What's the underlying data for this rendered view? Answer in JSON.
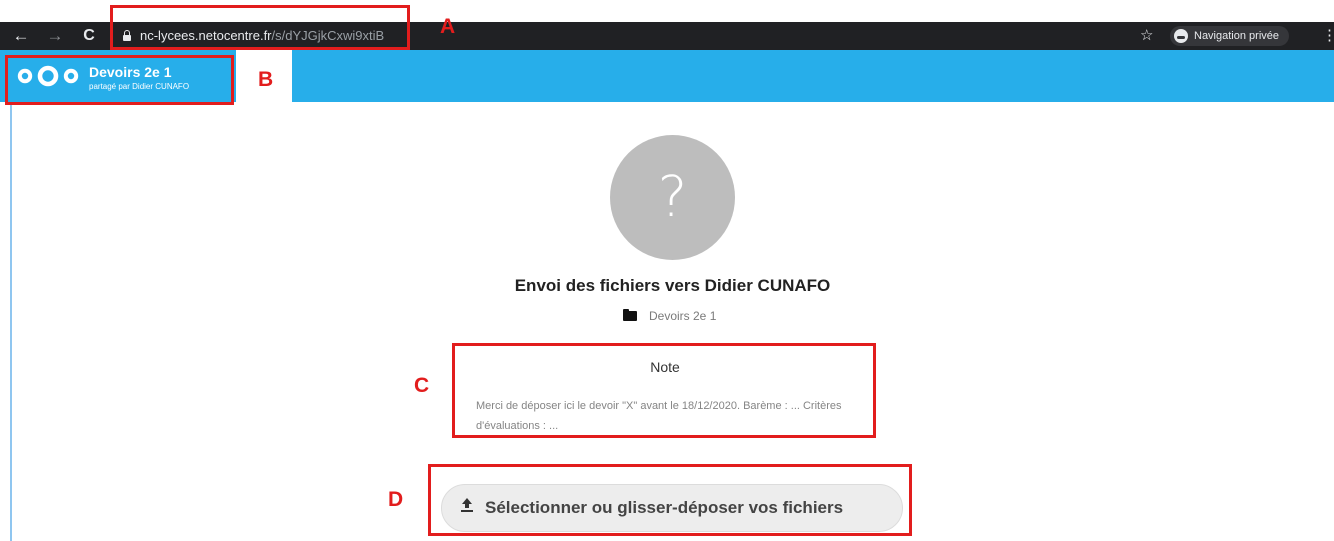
{
  "browser": {
    "url_host": "nc-lycees.netocentre.fr",
    "url_path": "/s/dYJGjkCxwi9xtiB",
    "incognito_label": "Navigation privée",
    "icons": [
      "back-icon",
      "forward-icon",
      "reload-icon",
      "lock-icon",
      "star-icon",
      "incognito-icon",
      "kebab-menu-icon"
    ]
  },
  "header": {
    "share_title": "Devoirs 2e 1",
    "share_subtitle": "partagé par Didier CUNAFO",
    "brand_color": "#27aeea"
  },
  "main": {
    "avatar_glyph": "?",
    "title": "Envoi des fichiers vers Didier CUNAFO",
    "folder_name": "Devoirs 2e 1",
    "note_title": "Note",
    "note_text": "Merci de déposer ici le devoir \"X\" avant le 18/12/2020. Barème : ... Critères d'évaluations : ...",
    "upload_button": "Sélectionner ou glisser-déposer vos fichiers"
  },
  "annotations": {
    "a": "A",
    "b": "B",
    "c": "C",
    "d": "D",
    "color": "#e21d1d"
  }
}
